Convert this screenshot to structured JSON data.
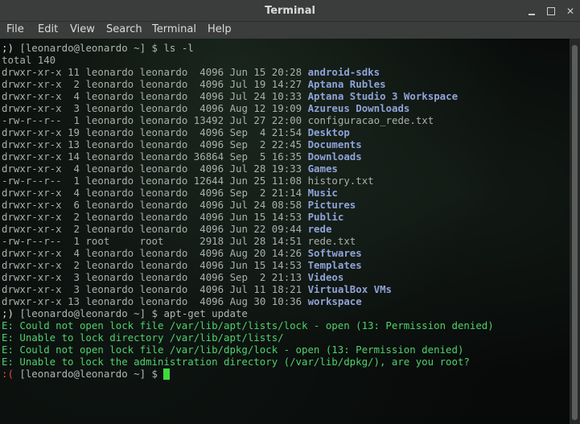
{
  "window": {
    "title": "Terminal",
    "controls": {
      "minimize": "minimize",
      "maximize": "maximize",
      "close": "✕"
    }
  },
  "menubar": {
    "items": [
      "File",
      "Edit",
      "View",
      "Search",
      "Terminal",
      "Help"
    ]
  },
  "terminal": {
    "prompt1": {
      "smile": ";)",
      "user": "[leonardo@leonardo ~]",
      "sign": "$",
      "command": "ls -l"
    },
    "total": "total 140",
    "listing": [
      {
        "perms": "drwxr-xr-x",
        "links": "11",
        "owner": "leonardo",
        "group": "leonardo",
        "size": "4096",
        "date": "Jun 15 20:28",
        "name": "android-sdks",
        "type": "dir"
      },
      {
        "perms": "drwxr-xr-x",
        "links": " 2",
        "owner": "leonardo",
        "group": "leonardo",
        "size": "4096",
        "date": "Jul 19 14:27",
        "name": "Aptana Rubles",
        "type": "dir"
      },
      {
        "perms": "drwxr-xr-x",
        "links": " 4",
        "owner": "leonardo",
        "group": "leonardo",
        "size": "4096",
        "date": "Jul 24 10:33",
        "name": "Aptana Studio 3 Workspace",
        "type": "dir"
      },
      {
        "perms": "drwxr-xr-x",
        "links": " 3",
        "owner": "leonardo",
        "group": "leonardo",
        "size": "4096",
        "date": "Aug 12 19:09",
        "name": "Azureus Downloads",
        "type": "dir"
      },
      {
        "perms": "-rw-r--r--",
        "links": " 1",
        "owner": "leonardo",
        "group": "leonardo",
        "size": "13492",
        "date": "Jul 27 22:00",
        "name": "configuracao_rede.txt",
        "type": "file"
      },
      {
        "perms": "drwxr-xr-x",
        "links": "19",
        "owner": "leonardo",
        "group": "leonardo",
        "size": "4096",
        "date": "Sep  4 21:54",
        "name": "Desktop",
        "type": "dir"
      },
      {
        "perms": "drwxr-xr-x",
        "links": "13",
        "owner": "leonardo",
        "group": "leonardo",
        "size": "4096",
        "date": "Sep  2 22:45",
        "name": "Documents",
        "type": "dir"
      },
      {
        "perms": "drwxr-xr-x",
        "links": "14",
        "owner": "leonardo",
        "group": "leonardo",
        "size": "36864",
        "date": "Sep  5 16:35",
        "name": "Downloads",
        "type": "dir"
      },
      {
        "perms": "drwxr-xr-x",
        "links": " 4",
        "owner": "leonardo",
        "group": "leonardo",
        "size": "4096",
        "date": "Jul 28 19:33",
        "name": "Games",
        "type": "dir"
      },
      {
        "perms": "-rw-r--r--",
        "links": " 1",
        "owner": "leonardo",
        "group": "leonardo",
        "size": "12644",
        "date": "Jun 25 11:08",
        "name": "history.txt",
        "type": "file"
      },
      {
        "perms": "drwxr-xr-x",
        "links": " 4",
        "owner": "leonardo",
        "group": "leonardo",
        "size": "4096",
        "date": "Sep  2 21:14",
        "name": "Music",
        "type": "dir"
      },
      {
        "perms": "drwxr-xr-x",
        "links": " 6",
        "owner": "leonardo",
        "group": "leonardo",
        "size": "4096",
        "date": "Jul 24 08:58",
        "name": "Pictures",
        "type": "dir"
      },
      {
        "perms": "drwxr-xr-x",
        "links": " 2",
        "owner": "leonardo",
        "group": "leonardo",
        "size": "4096",
        "date": "Jun 15 14:53",
        "name": "Public",
        "type": "dir"
      },
      {
        "perms": "drwxr-xr-x",
        "links": " 2",
        "owner": "leonardo",
        "group": "leonardo",
        "size": "4096",
        "date": "Jun 22 09:44",
        "name": "rede",
        "type": "dir"
      },
      {
        "perms": "-rw-r--r--",
        "links": " 1",
        "owner": "root",
        "group": "root",
        "size": "2918",
        "date": "Jul 28 14:51",
        "name": "rede.txt",
        "type": "file"
      },
      {
        "perms": "drwxr-xr-x",
        "links": " 4",
        "owner": "leonardo",
        "group": "leonardo",
        "size": "4096",
        "date": "Aug 20 14:26",
        "name": "Softwares",
        "type": "dir"
      },
      {
        "perms": "drwxr-xr-x",
        "links": " 2",
        "owner": "leonardo",
        "group": "leonardo",
        "size": "4096",
        "date": "Jun 15 14:53",
        "name": "Templates",
        "type": "dir"
      },
      {
        "perms": "drwxr-xr-x",
        "links": " 3",
        "owner": "leonardo",
        "group": "leonardo",
        "size": "4096",
        "date": "Sep  2 21:13",
        "name": "Videos",
        "type": "dir"
      },
      {
        "perms": "drwxr-xr-x",
        "links": " 3",
        "owner": "leonardo",
        "group": "leonardo",
        "size": "4096",
        "date": "Jul 11 18:21",
        "name": "VirtualBox VMs",
        "type": "dir"
      },
      {
        "perms": "drwxr-xr-x",
        "links": "13",
        "owner": "leonardo",
        "group": "leonardo",
        "size": "4096",
        "date": "Aug 30 10:36",
        "name": "workspace",
        "type": "dir"
      }
    ],
    "prompt2": {
      "smile": ";)",
      "user": "[leonardo@leonardo ~]",
      "sign": "$",
      "command": "apt-get update"
    },
    "errors": [
      "E: Could not open lock file /var/lib/apt/lists/lock - open (13: Permission denied)",
      "E: Unable to lock directory /var/lib/apt/lists/",
      "E: Could not open lock file /var/lib/dpkg/lock - open (13: Permission denied)",
      "E: Unable to lock the administration directory (/var/lib/dpkg/), are you root?"
    ],
    "prompt3": {
      "smile": ":(",
      "user": "[leonardo@leonardo ~]",
      "sign": "$"
    }
  },
  "colors": {
    "directory": "#8fa3d8",
    "error_text": "#4fd06b",
    "sad_prompt": "#e04b4b",
    "cursor": "#3ddc3d"
  }
}
